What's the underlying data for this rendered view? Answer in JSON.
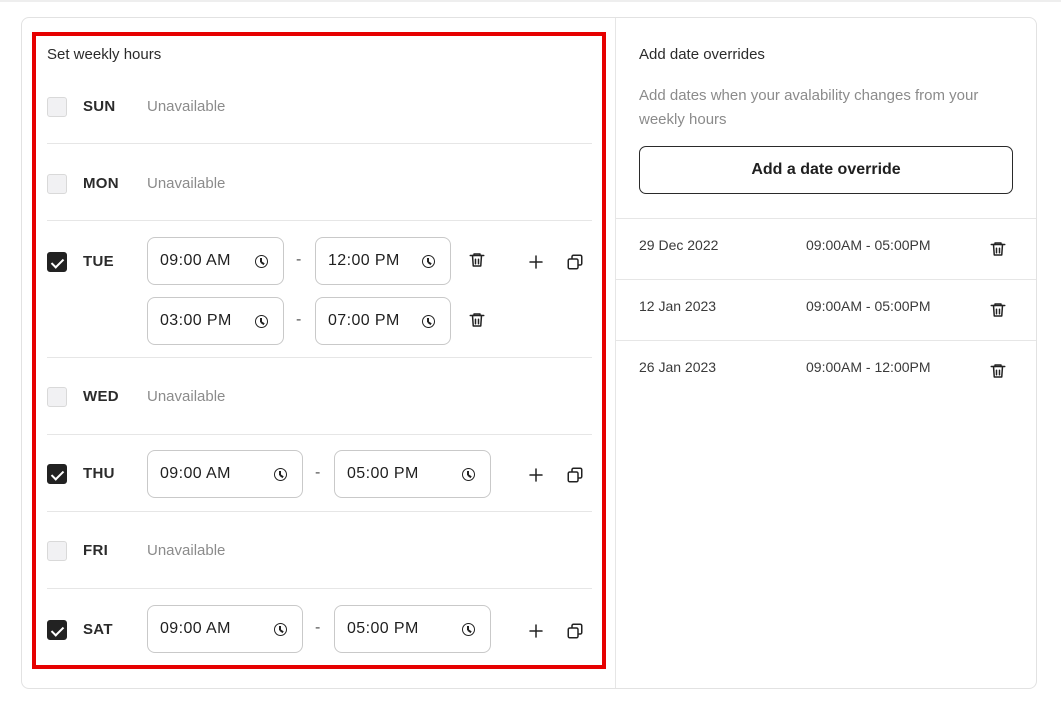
{
  "weekly": {
    "title": "Set weekly hours",
    "unavailable_label": "Unavailable",
    "separator": "-",
    "days": [
      {
        "label": "SUN",
        "checked": false
      },
      {
        "label": "MON",
        "checked": false
      },
      {
        "label": "TUE",
        "checked": true,
        "slots": [
          {
            "start": "09:00 AM",
            "end": "12:00 PM"
          },
          {
            "start": "03:00 PM",
            "end": "07:00 PM"
          }
        ]
      },
      {
        "label": "WED",
        "checked": false
      },
      {
        "label": "THU",
        "checked": true,
        "slots": [
          {
            "start": "09:00 AM",
            "end": "05:00 PM"
          }
        ]
      },
      {
        "label": "FRI",
        "checked": false
      },
      {
        "label": "SAT",
        "checked": true,
        "slots": [
          {
            "start": "09:00 AM",
            "end": "05:00 PM"
          }
        ]
      }
    ]
  },
  "overrides": {
    "title": "Add date overrides",
    "description": "Add dates when your avalability changes from your weekly hours",
    "add_button_label": "Add a date override",
    "items": [
      {
        "date": "29 Dec 2022",
        "time": "09:00AM - 05:00PM"
      },
      {
        "date": "12 Jan 2023",
        "time": "09:00AM - 05:00PM"
      },
      {
        "date": "26 Jan 2023",
        "time": "09:00AM - 12:00PM"
      }
    ]
  },
  "icons": {
    "checkbox": "checkbox-icon",
    "clock": "clock-icon",
    "delete": "trash-icon",
    "add": "plus-icon",
    "copy": "copy-icon"
  },
  "colors": {
    "highlight": "#e60000",
    "checked": "#222222",
    "muted_text": "#8b8b8b"
  }
}
